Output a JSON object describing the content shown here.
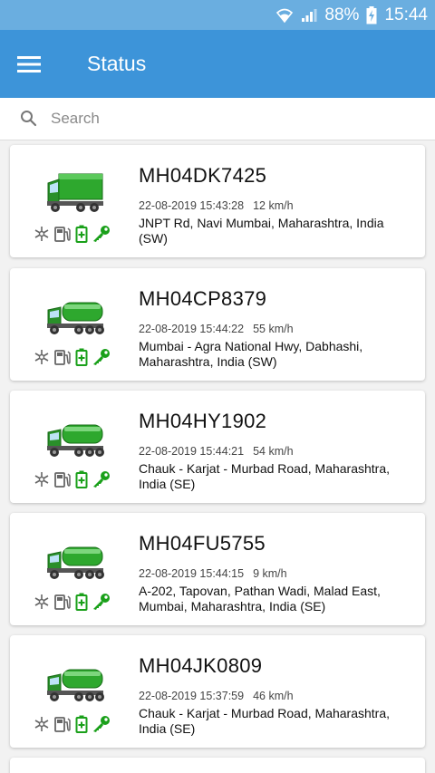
{
  "status_bar": {
    "battery": "88%",
    "time": "15:44"
  },
  "header": {
    "title": "Status"
  },
  "search": {
    "placeholder": "Search"
  },
  "vehicles": [
    {
      "plate": "MH04DK7425",
      "timestamp": "22-08-2019 15:43:28",
      "speed": "12 km/h",
      "address": "JNPT Rd, Navi Mumbai, Maharashtra,  India (SW)",
      "vehicle_icon": "truck-icon"
    },
    {
      "plate": "MH04CP8379",
      "timestamp": "22-08-2019 15:44:22",
      "speed": "55 km/h",
      "address": "Mumbai - Agra National Hwy,  Dabhashi, Maharashtra,  India (SW)",
      "vehicle_icon": "tanker-icon"
    },
    {
      "plate": "MH04HY1902",
      "timestamp": "22-08-2019 15:44:21",
      "speed": "54 km/h",
      "address": "Chauk - Karjat - Murbad Road, Maharashtra,  India (SE)",
      "vehicle_icon": "tanker-icon"
    },
    {
      "plate": "MH04FU5755",
      "timestamp": "22-08-2019 15:44:15",
      "speed": "9 km/h",
      "address": "A-202,  Tapovan,  Pathan Wadi,  Malad East,  Mumbai, Maharashtra,  India (SE)",
      "vehicle_icon": "tanker-icon"
    },
    {
      "plate": "MH04JK0809",
      "timestamp": "22-08-2019 15:37:59",
      "speed": "46 km/h",
      "address": "Chauk - Karjat - Murbad Road, Maharashtra,  India (SE)",
      "vehicle_icon": "tanker-icon"
    }
  ],
  "status_icons": [
    "snowflake-icon",
    "fuel-icon",
    "battery-icon",
    "ignition-key-icon"
  ],
  "colors": {
    "app_bar": "#3d94d9",
    "status_bar": "#6aaee0",
    "vehicle_green": "#2ea82e",
    "status_icon_green": "#1aa01a"
  }
}
